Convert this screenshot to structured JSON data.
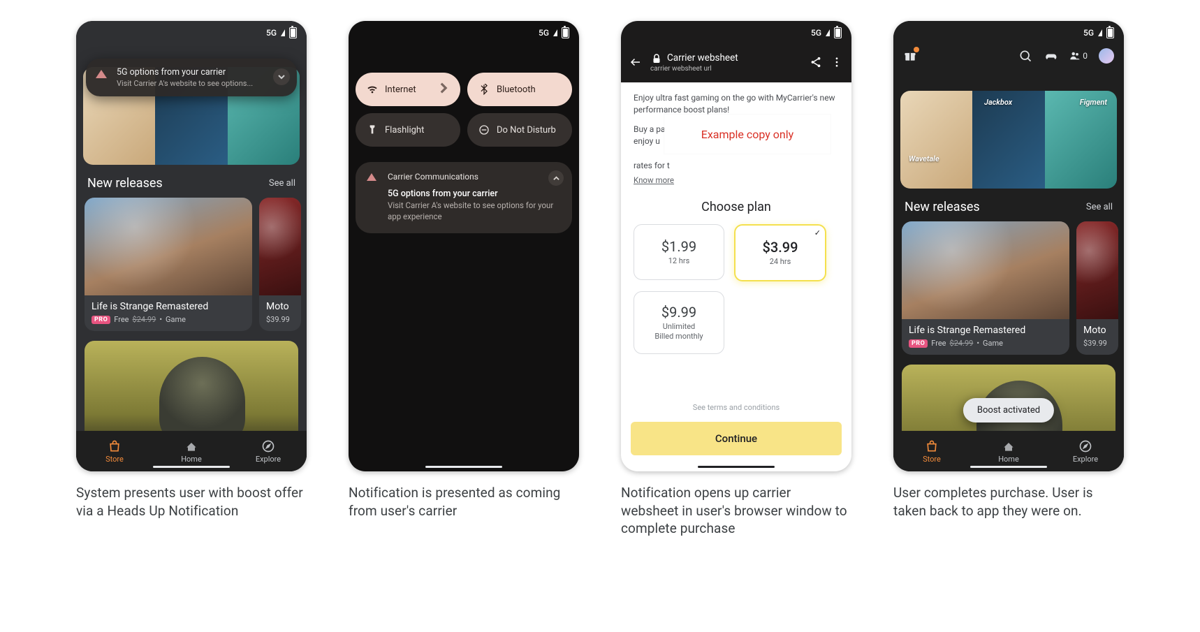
{
  "status": {
    "network": "5G"
  },
  "captions": [
    "System presents user with boost offer via a Heads Up Notification",
    "Notification is presented as coming from user's carrier",
    "Notification opens up carrier websheet in user's browser window to complete purchase",
    "User completes purchase. User is taken back to app they were on."
  ],
  "store": {
    "section_title": "New releases",
    "see_all": "See all",
    "hero_labels": [
      "Wavetale",
      "Jackbox",
      "Figment"
    ],
    "card1": {
      "name": "Life is Strange Remastered",
      "pro": "PRO",
      "free": "Free",
      "orig": "$24.99",
      "kind": "Game"
    },
    "card2": {
      "name": "Moto",
      "price": "$39.99"
    },
    "tabs": {
      "store": "Store",
      "home": "Home",
      "explore": "Explore"
    },
    "friends": "0"
  },
  "hun": {
    "title": "5G options from your carrier",
    "body": "Visit Carrier A's website to see options..."
  },
  "qs": {
    "internet": "Internet",
    "bluetooth": "Bluetooth",
    "flashlight": "Flashlight",
    "dnd": "Do Not Disturb"
  },
  "notif": {
    "app": "Carrier Communications",
    "title": "5G options from your carrier",
    "body": "Visit Carrier A's website to see options for your app experience"
  },
  "websheet": {
    "title": "Carrier websheet",
    "url": "carrier websheet url",
    "intro1": "Enjoy ultra fast gaming on the go with MyCarrier's new performance boost plans!",
    "intro2_a": "Buy a pas",
    "intro2_b": "plan to enjoy u",
    "intro2_c": "rates for t",
    "overlay": "Example copy only",
    "know_more": "Know more",
    "choose": "Choose plan",
    "plans": [
      {
        "price": "$1.99",
        "dur": "12 hrs"
      },
      {
        "price": "$3.99",
        "dur": "24 hrs"
      },
      {
        "price": "$9.99",
        "dur": "Unlimited\nBilled monthly"
      }
    ],
    "terms": "See terms and conditions",
    "continue": "Continue"
  },
  "toast": "Boost activated"
}
